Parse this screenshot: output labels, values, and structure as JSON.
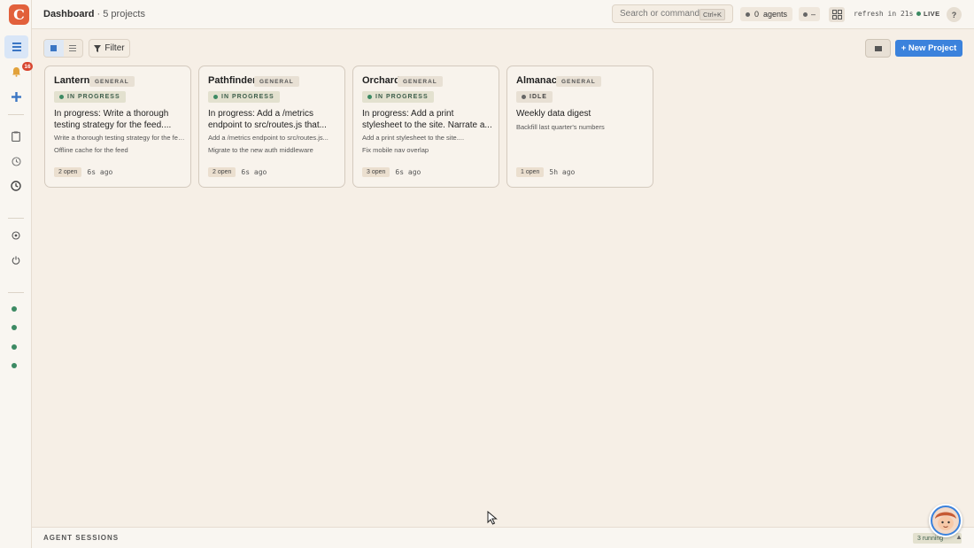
{
  "app": {
    "logo_letter": "C",
    "accent": "#e2603b",
    "primary": "#3b82dc",
    "live_color": "#3c8a63"
  },
  "sidebar": {
    "badge_count": "16",
    "items": [
      {
        "icon": "grid-icon",
        "active": true
      },
      {
        "icon": "bell-icon"
      },
      {
        "icon": "plus-icon"
      },
      {
        "icon": "clipboard-icon"
      },
      {
        "icon": "history-icon"
      },
      {
        "icon": "clock-icon"
      },
      {
        "icon": "target-icon"
      },
      {
        "icon": "power-icon"
      }
    ],
    "status_dots": 4
  },
  "header": {
    "title": "Dashboard",
    "subtitle": "· 5 projects",
    "search_placeholder": "Search or command...",
    "search_shortcut": "Ctrl+K",
    "agents_count": "0",
    "agents_label": "agents",
    "status_value": "–",
    "refresh_text": "refresh in 21s",
    "live_label": "LIVE",
    "help_label": "?"
  },
  "toolbar": {
    "filter_label": "Filter",
    "new_project_label": "+ New Project"
  },
  "projects": [
    {
      "name": "Lantern",
      "tag": "GENERAL",
      "state": "IN PROGRESS",
      "description": "In progress: Write a thorough testing strategy for the feed....",
      "line1": "Write a thorough testing strategy for the feed...",
      "line2": "Offline cache for the feed",
      "open": "2 open",
      "ago": "6s ago"
    },
    {
      "name": "Pathfinder",
      "tag": "GENERAL",
      "state": "IN PROGRESS",
      "description": "In progress: Add a /metrics endpoint to src/routes.js that...",
      "line1": "Add a /metrics endpoint to src/routes.js...",
      "line2": "Migrate to the new auth middleware",
      "open": "2 open",
      "ago": "6s ago"
    },
    {
      "name": "Orchard",
      "tag": "GENERAL",
      "state": "IN PROGRESS",
      "description": "In progress: Add a print stylesheet to the site. Narrate a...",
      "line1": "Add a print stylesheet to the site....",
      "line2": "Fix mobile nav overlap",
      "open": "3 open",
      "ago": "6s ago"
    },
    {
      "name": "Almanac",
      "tag": "GENERAL",
      "state": "IDLE",
      "description": "Weekly data digest",
      "line1": "Backfill last quarter's numbers",
      "line2": "",
      "open": "1 open",
      "ago": "5h ago"
    }
  ],
  "footer": {
    "label": "AGENT SESSIONS",
    "running": "3 running"
  }
}
